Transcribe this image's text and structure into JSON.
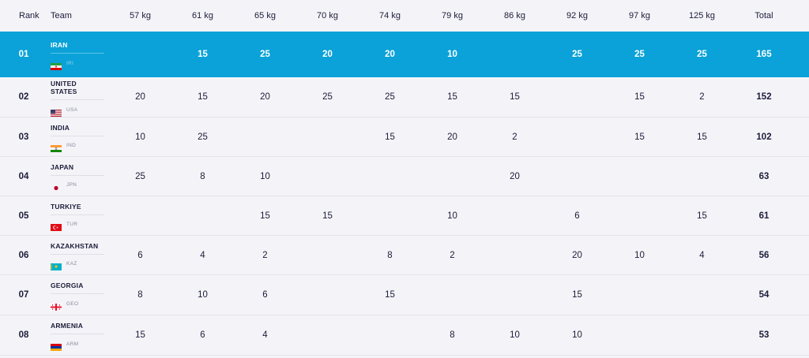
{
  "header": {
    "rank": "Rank",
    "team": "Team",
    "weights": [
      "57 kg",
      "61 kg",
      "65 kg",
      "70 kg",
      "74 kg",
      "79 kg",
      "86 kg",
      "92 kg",
      "97 kg",
      "125 kg"
    ],
    "total": "Total"
  },
  "rows": [
    {
      "rank": "01",
      "team": "IRAN",
      "code": "IRI",
      "flag": "iran-flag-icon",
      "scores": [
        "",
        "15",
        "25",
        "20",
        "20",
        "10",
        "",
        "25",
        "25",
        "25"
      ],
      "total": "165",
      "highlight": true
    },
    {
      "rank": "02",
      "team": "UNITED STATES",
      "code": "USA",
      "flag": "usa-flag-icon",
      "scores": [
        "20",
        "15",
        "20",
        "25",
        "25",
        "15",
        "15",
        "",
        "15",
        "2"
      ],
      "total": "152"
    },
    {
      "rank": "03",
      "team": "INDIA",
      "code": "IND",
      "flag": "india-flag-icon",
      "scores": [
        "10",
        "25",
        "",
        "",
        "15",
        "20",
        "2",
        "",
        "15",
        "15"
      ],
      "total": "102"
    },
    {
      "rank": "04",
      "team": "JAPAN",
      "code": "JPN",
      "flag": "japan-flag-icon",
      "scores": [
        "25",
        "8",
        "10",
        "",
        "",
        "",
        "20",
        "",
        "",
        ""
      ],
      "total": "63"
    },
    {
      "rank": "05",
      "team": "TURKIYE",
      "code": "TUR",
      "flag": "turkiye-flag-icon",
      "scores": [
        "",
        "",
        "15",
        "15",
        "",
        "10",
        "",
        "6",
        "",
        "15"
      ],
      "total": "61"
    },
    {
      "rank": "06",
      "team": "KAZAKHSTAN",
      "code": "KAZ",
      "flag": "kazakhstan-flag-icon",
      "scores": [
        "6",
        "4",
        "2",
        "",
        "8",
        "2",
        "",
        "20",
        "10",
        "4"
      ],
      "total": "56"
    },
    {
      "rank": "07",
      "team": "GEORGIA",
      "code": "GEO",
      "flag": "georgia-flag-icon",
      "scores": [
        "8",
        "10",
        "6",
        "",
        "15",
        "",
        "",
        "15",
        "",
        ""
      ],
      "total": "54"
    },
    {
      "rank": "08",
      "team": "ARMENIA",
      "code": "ARM",
      "flag": "armenia-flag-icon",
      "scores": [
        "15",
        "6",
        "4",
        "",
        "",
        "8",
        "10",
        "10",
        "",
        ""
      ],
      "total": "53"
    }
  ],
  "colors": {
    "highlight": "#0aa2d8",
    "text": "#1c1c3a",
    "background": "#f4f4f8"
  }
}
